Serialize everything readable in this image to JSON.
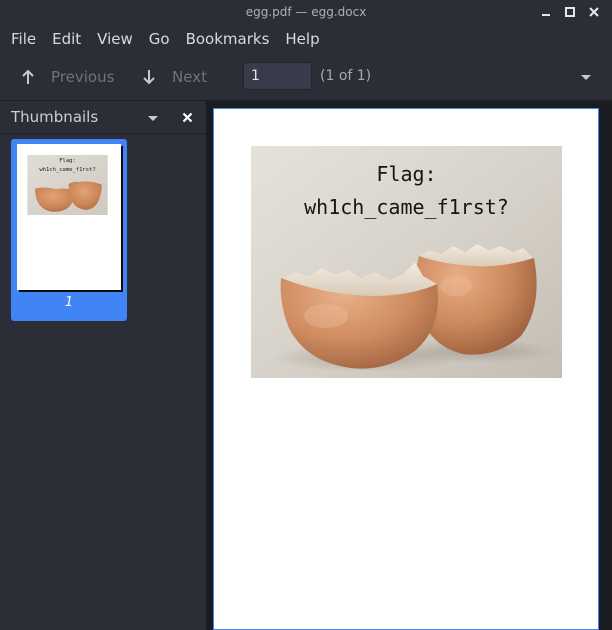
{
  "window": {
    "title": "egg.pdf — egg.docx",
    "minimize_icon": "minimize-icon",
    "maximize_icon": "maximize-icon",
    "close_icon": "close-icon"
  },
  "menubar": {
    "items": [
      {
        "label": "File"
      },
      {
        "label": "Edit"
      },
      {
        "label": "View"
      },
      {
        "label": "Go"
      },
      {
        "label": "Bookmarks"
      },
      {
        "label": "Help"
      }
    ]
  },
  "toolbar": {
    "previous_label": "Previous",
    "next_label": "Next",
    "page_value": "1",
    "page_count": "(1 of 1)",
    "up_icon": "arrow-up-icon",
    "down_icon": "arrow-down-icon",
    "menu_icon": "chevron-down-icon"
  },
  "sidebar": {
    "title": "Thumbnails",
    "close_icon": "close-icon",
    "dropdown_icon": "chevron-down-icon",
    "thumbnails": [
      {
        "page_number": "1",
        "selected": true
      }
    ]
  },
  "document": {
    "image_text_line1": "Flag:",
    "image_text_line2": "wh1ch_came_f1rst?"
  },
  "colors": {
    "accent": "#4084f5",
    "window_bg": "#2b2e36",
    "page_bg": "#ffffff"
  }
}
